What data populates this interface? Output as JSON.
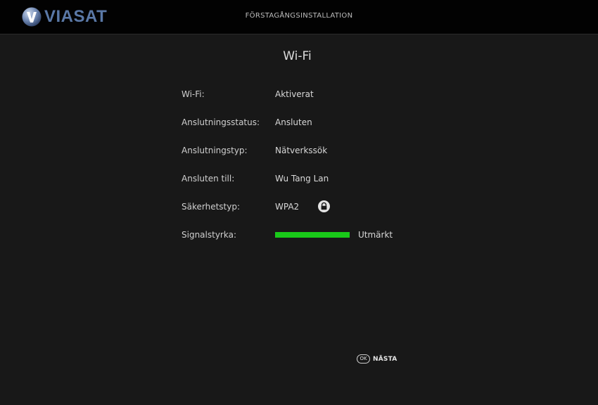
{
  "header": {
    "brand": "VIASAT",
    "title": "FÖRSTAGÅNGSINSTALLATION"
  },
  "page": {
    "title": "Wi-Fi"
  },
  "rows": [
    {
      "label": "Wi-Fi:",
      "value": "Aktiverat"
    },
    {
      "label": "Anslutningsstatus:",
      "value": "Ansluten"
    },
    {
      "label": "Anslutningstyp:",
      "value": "Nätverkssök"
    },
    {
      "label": "Ansluten till:",
      "value": "Wu Tang Lan"
    },
    {
      "label": "Säkerhetstyp:",
      "value": "WPA2",
      "icon": "lock-icon"
    },
    {
      "label": "Signalstyrka:",
      "value": "Utmärkt"
    }
  ],
  "signal": {
    "level": 1.0,
    "color": "#19c919"
  },
  "footer": {
    "ok_key": "OK",
    "next_label": "NÄSTA"
  },
  "colors": {
    "background": "#181818",
    "topbar": "#020202",
    "brand": "#5a78a6",
    "signal": "#19c919"
  }
}
